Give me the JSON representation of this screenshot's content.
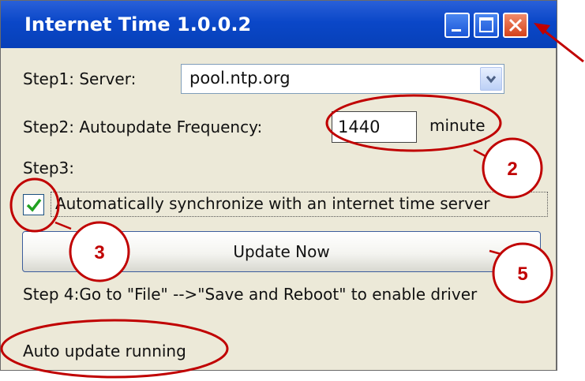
{
  "window": {
    "title": "Internet Time 1.0.0.2"
  },
  "step1": {
    "label": "Step1: Server:",
    "server_value": "pool.ntp.org"
  },
  "step2": {
    "label": "Step2: Autoupdate Frequency:",
    "frequency_value": "1440",
    "unit": "minute"
  },
  "step3": {
    "label": "Step3:",
    "checkbox_checked": true,
    "checkbox_label": "Automatically synchronize with an internet time server"
  },
  "update_button": {
    "label": "Update Now"
  },
  "step4": {
    "text": "Step 4:Go to \"File\" -->\"Save and Reboot\" to enable driver"
  },
  "status": {
    "text": "Auto update running"
  },
  "annotations": {
    "badge_2": "2",
    "badge_3": "3",
    "badge_5": "5"
  },
  "colors": {
    "annotation": "#c00000",
    "titlebar": "#0a47c8",
    "close_button": "#d6421a"
  }
}
